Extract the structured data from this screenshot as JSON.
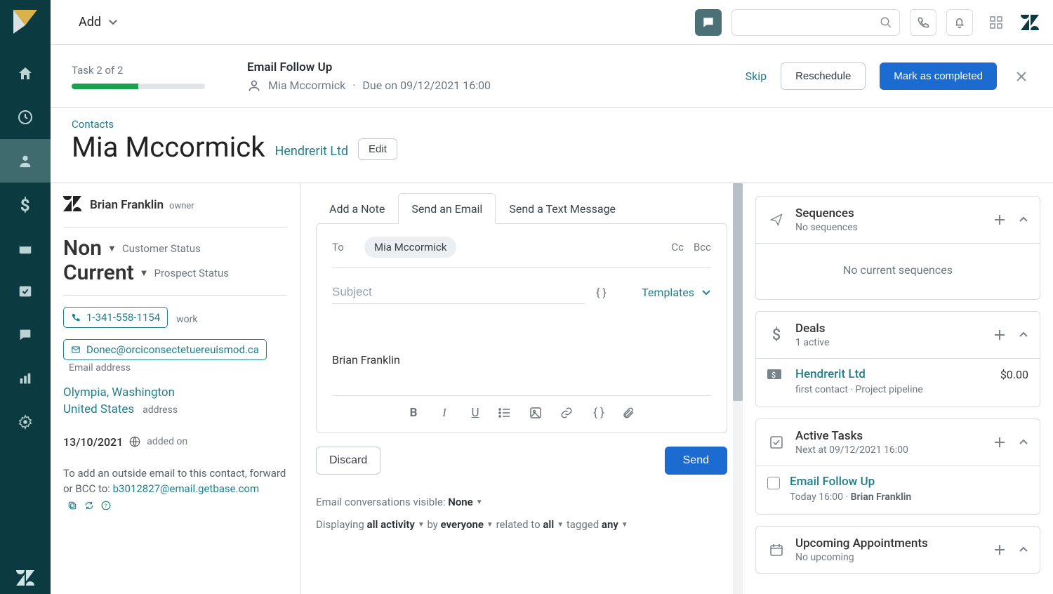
{
  "top": {
    "add_label": "Add",
    "search_placeholder": ""
  },
  "task_header": {
    "progress_label": "Task 2 of 2",
    "progress_pct": 50,
    "title": "Email Follow Up",
    "person": "Mia Mccormick",
    "due": "Due on 09/12/2021 16:00",
    "skip": "Skip",
    "reschedule": "Reschedule",
    "complete": "Mark as completed"
  },
  "contact": {
    "breadcrumb": "Contacts",
    "name": "Mia Mccormick",
    "company": "Hendrerit Ltd",
    "edit": "Edit"
  },
  "owner": {
    "name": "Brian Franklin",
    "role": "owner"
  },
  "statuses": {
    "customer_value": "Non",
    "customer_label": "Customer Status",
    "prospect_value": "Current",
    "prospect_label": "Prospect Status"
  },
  "details": {
    "phone": "1-341-558-1154",
    "phone_label": "work",
    "email": "Donec@orciconsectetuereuismod.ca",
    "email_label": "Email address",
    "addr_line1": "Olympia, Washington",
    "addr_line2": "United States",
    "addr_label": "address",
    "added_date": "13/10/2021",
    "added_label": "added on",
    "forward_note_pre": "To add an outside email to this contact, forward or BCC to: ",
    "forward_addr": "b3012827@email.getbase.com"
  },
  "compose": {
    "tab_note": "Add a Note",
    "tab_email": "Send an Email",
    "tab_sms": "Send a Text Message",
    "to_label": "To",
    "to_chip": "Mia Mccormick",
    "cc": "Cc",
    "bcc": "Bcc",
    "subject_placeholder": "Subject",
    "templates": "Templates",
    "body": "Brian Franklin",
    "discard": "Discard",
    "send": "Send"
  },
  "filters": {
    "visible_pre": "Email conversations visible: ",
    "visible_val": "None",
    "disp_pre": "Displaying ",
    "disp_activity": "all activity",
    "disp_by": " by ",
    "disp_everyone": "everyone",
    "disp_related": " related to ",
    "disp_all": "all",
    "disp_tagged": " tagged ",
    "disp_any": "any"
  },
  "panels": {
    "sequences": {
      "title": "Sequences",
      "sub": "No sequences",
      "empty": "No current sequences"
    },
    "deals": {
      "title": "Deals",
      "sub": "1 active",
      "name": "Hendrerit Ltd",
      "amount": "$0.00",
      "detail": "first contact · Project pipeline"
    },
    "tasks": {
      "title": "Active Tasks",
      "sub": "Next at 09/12/2021 16:00",
      "item_title": "Email Follow Up",
      "item_sub_pre": "Today 16:00 · ",
      "item_sub_owner": "Brian Franklin"
    },
    "appts": {
      "title": "Upcoming Appointments",
      "sub": "No upcoming"
    }
  }
}
